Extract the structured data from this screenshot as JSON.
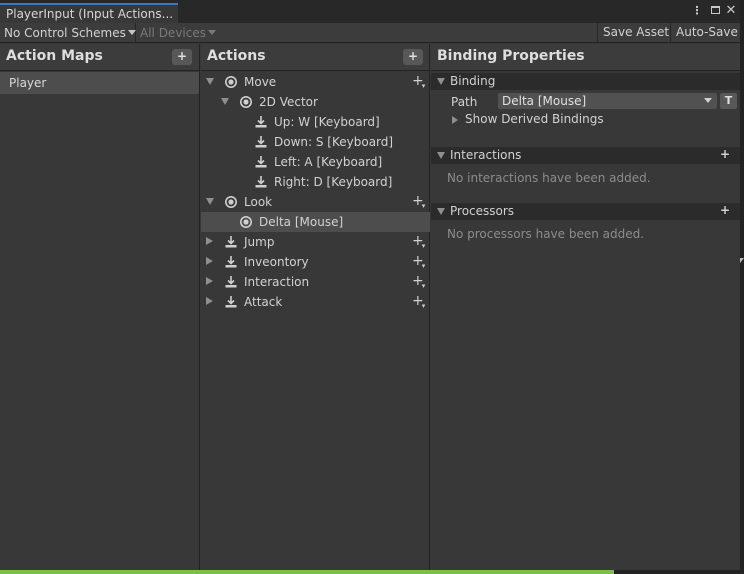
{
  "window": {
    "tab_title": "PlayerInput (Input Actions...",
    "menu_glyph": "⋮",
    "close_glyph": "✕"
  },
  "toolbar": {
    "control_schemes": "No Control Schemes",
    "devices": "All Devices",
    "save_asset": "Save Asset",
    "auto_save": "Auto-Save"
  },
  "action_maps": {
    "header": "Action Maps",
    "add": "+",
    "items": [
      {
        "label": "Player",
        "selected": true
      }
    ]
  },
  "actions": {
    "header": "Actions",
    "add": "+",
    "rows": [
      {
        "label": "Move",
        "kind": "action",
        "expanded": true,
        "depth": 0
      },
      {
        "label": "2D Vector",
        "kind": "composite",
        "expanded": true,
        "depth": 1
      },
      {
        "label": "Up: W [Keyboard]",
        "kind": "binding",
        "depth": 2
      },
      {
        "label": "Down: S [Keyboard]",
        "kind": "binding",
        "depth": 2
      },
      {
        "label": "Left: A [Keyboard]",
        "kind": "binding",
        "depth": 2
      },
      {
        "label": "Right: D [Keyboard]",
        "kind": "binding",
        "depth": 2
      },
      {
        "label": "Look",
        "kind": "action",
        "expanded": true,
        "depth": 0
      },
      {
        "label": "Delta [Mouse]",
        "kind": "binding-value",
        "depth": 1,
        "selected": true
      },
      {
        "label": "Jump",
        "kind": "button-action",
        "expanded": false,
        "depth": 0
      },
      {
        "label": "Inveontory",
        "kind": "button-action",
        "expanded": false,
        "depth": 0
      },
      {
        "label": "Interaction",
        "kind": "button-action",
        "expanded": false,
        "depth": 0
      },
      {
        "label": "Attack",
        "kind": "button-action",
        "expanded": false,
        "depth": 0
      }
    ]
  },
  "properties": {
    "header": "Binding Properties",
    "binding_section": "Binding",
    "path_label": "Path",
    "path_value": "Delta [Mouse]",
    "t_button": "T",
    "derived_bindings": "Show Derived Bindings",
    "interactions_section": "Interactions",
    "interactions_empty": "No interactions have been added.",
    "processors_section": "Processors",
    "processors_empty": "No processors have been added.",
    "section_add": "+"
  },
  "colors": {
    "accent_tab": "#3a79bb",
    "selection": "#4d4d4d",
    "bottom_bar": "#7cc242"
  }
}
